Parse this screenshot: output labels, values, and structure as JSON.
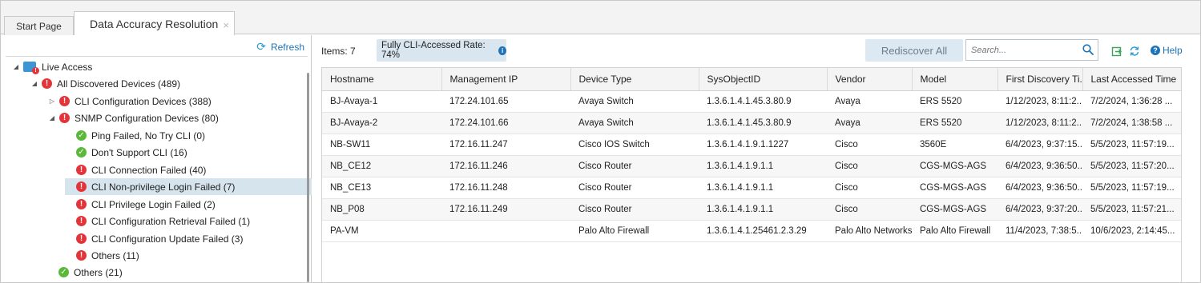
{
  "tabs": [
    {
      "label": "Start Page"
    },
    {
      "label": "Data Accuracy Resolution"
    }
  ],
  "tab_close_glyph": "×",
  "left": {
    "refresh_label": "Refresh",
    "tree": [
      {
        "label": "Live Access"
      },
      {
        "label": "All Discovered Devices (489)"
      },
      {
        "label": "CLI Configuration Devices (388)"
      },
      {
        "label": "SNMP Configuration Devices (80)"
      },
      {
        "label": "Ping Failed, No Try CLI (0)"
      },
      {
        "label": "Don't Support CLI (16)"
      },
      {
        "label": "CLI Connection Failed (40)"
      },
      {
        "label": "CLI Non-privilege Login Failed (7)"
      },
      {
        "label": "CLI Privilege Login Failed (2)"
      },
      {
        "label": "CLI Configuration Retrieval Failed (1)"
      },
      {
        "label": "CLI Configuration Update Failed (3)"
      },
      {
        "label": "Others (11)"
      },
      {
        "label": "Others (21)"
      }
    ]
  },
  "toolbar": {
    "items": "Items: 7",
    "rate": "Fully CLI-Accessed Rate: 74%",
    "rediscover": "Rediscover All",
    "search_placeholder": "Search...",
    "help": "Help"
  },
  "table": {
    "columns": [
      "Hostname",
      "Management IP",
      "Device Type",
      "SysObjectID",
      "Vendor",
      "Model",
      "First Discovery Ti...",
      "Last Accessed Time"
    ],
    "rows": [
      [
        "BJ-Avaya-1",
        "172.24.101.65",
        "Avaya Switch",
        "1.3.6.1.4.1.45.3.80.9",
        "Avaya",
        "ERS 5520",
        "1/12/2023, 8:11:2...",
        "7/2/2024, 1:36:28 ..."
      ],
      [
        "BJ-Avaya-2",
        "172.24.101.66",
        "Avaya Switch",
        "1.3.6.1.4.1.45.3.80.9",
        "Avaya",
        "ERS 5520",
        "1/12/2023, 8:11:2...",
        "7/2/2024, 1:38:58 ..."
      ],
      [
        "NB-SW11",
        "172.16.11.247",
        "Cisco IOS Switch",
        "1.3.6.1.4.1.9.1.1227",
        "Cisco",
        "3560E",
        "6/4/2023, 9:37:15...",
        "5/5/2023, 11:57:19..."
      ],
      [
        "NB_CE12",
        "172.16.11.246",
        "Cisco Router",
        "1.3.6.1.4.1.9.1.1",
        "Cisco",
        "CGS-MGS-AGS",
        "6/4/2023, 9:36:50...",
        "5/5/2023, 11:57:20..."
      ],
      [
        "NB_CE13",
        "172.16.11.248",
        "Cisco Router",
        "1.3.6.1.4.1.9.1.1",
        "Cisco",
        "CGS-MGS-AGS",
        "6/4/2023, 9:36:50...",
        "5/5/2023, 11:57:19..."
      ],
      [
        "NB_P08",
        "172.16.11.249",
        "Cisco Router",
        "1.3.6.1.4.1.9.1.1",
        "Cisco",
        "CGS-MGS-AGS",
        "6/4/2023, 9:37:20...",
        "5/5/2023, 11:57:21..."
      ],
      [
        "PA-VM",
        "",
        "Palo Alto Firewall",
        "1.3.6.1.4.1.25461.2.3.29",
        "Palo Alto Networks",
        "Palo Alto Firewall",
        "11/4/2023, 7:38:5...",
        "10/6/2023, 2:14:45..."
      ]
    ]
  },
  "colors": {
    "accent": "#1e74b7",
    "error": "#e3343a",
    "ok": "#5ab93a",
    "selection": "#d6e4ee"
  }
}
